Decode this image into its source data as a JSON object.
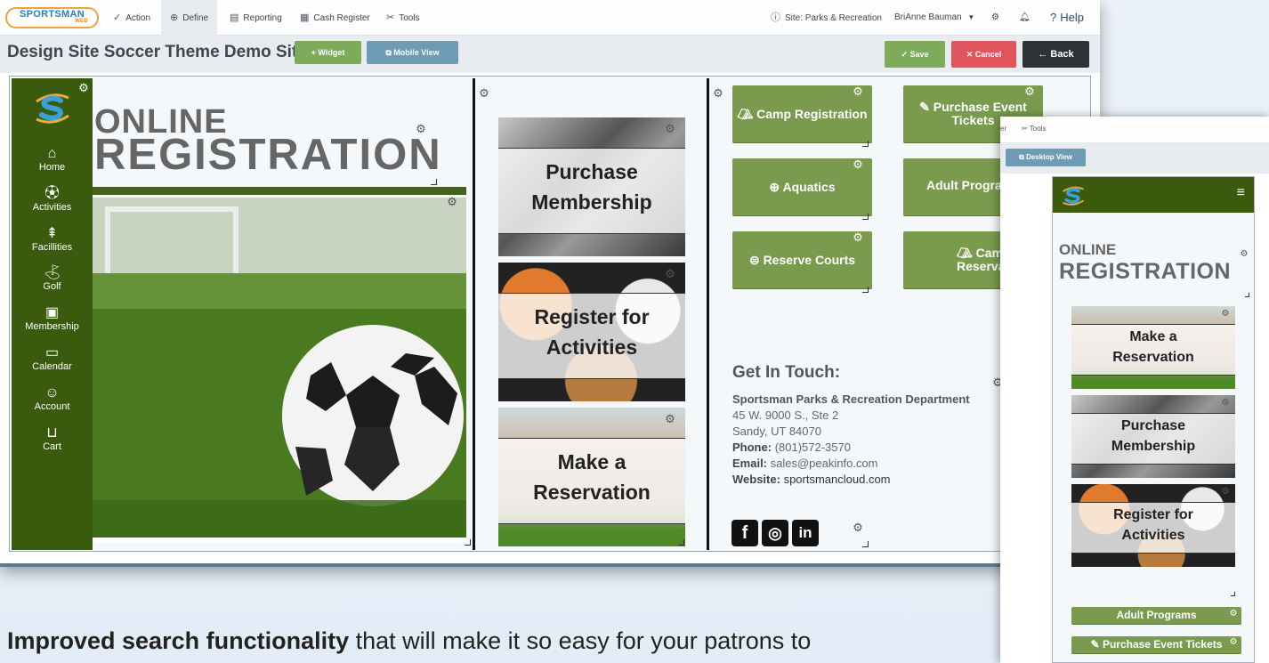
{
  "app": {
    "logo": {
      "text": "SPORTSMAN",
      "sub": "WEB"
    },
    "nav": [
      {
        "label": "Action",
        "icon": "check-icon"
      },
      {
        "label": "Define",
        "icon": "plus-circle-icon"
      },
      {
        "label": "Reporting",
        "icon": "document-icon"
      },
      {
        "label": "Cash Register",
        "icon": "register-icon"
      },
      {
        "label": "Tools",
        "icon": "tools-icon"
      }
    ],
    "site": "Site: Parks & Recreation",
    "user": "BriAnne Bauman",
    "help": "Help"
  },
  "toolbar": {
    "title": "Design Site Soccer Theme Demo Site",
    "widget": "Widget",
    "mobile_view": "Mobile View",
    "save": "Save",
    "cancel": "Cancel",
    "back": "Back"
  },
  "sidebar": {
    "items": [
      {
        "label": "Home",
        "icon": "home-icon"
      },
      {
        "label": "Activities",
        "icon": "soccer-ball-icon"
      },
      {
        "label": "Facillities",
        "icon": "tree-icon"
      },
      {
        "label": "Golf",
        "icon": "golf-icon"
      },
      {
        "label": "Membership",
        "icon": "id-card-icon"
      },
      {
        "label": "Calendar",
        "icon": "calendar-icon"
      },
      {
        "label": "Account",
        "icon": "user-icon"
      },
      {
        "label": "Cart",
        "icon": "cart-icon"
      }
    ]
  },
  "hero": {
    "line1": "ONLINE",
    "line2": "REGISTRATION"
  },
  "tiles": [
    {
      "title1": "Purchase",
      "title2": "Membership"
    },
    {
      "title1": "Register for",
      "title2": "Activities"
    },
    {
      "title1": "Make a",
      "title2": "Reservation"
    }
  ],
  "buttons": [
    {
      "label": "Camp Registration",
      "icon": "tent-icon"
    },
    {
      "label": "Purchase Event Tickets",
      "icon": "ticket-icon"
    },
    {
      "label": "Aquatics",
      "icon": "lifebuoy-icon"
    },
    {
      "label": "Adult Programs",
      "icon": ""
    },
    {
      "label": "Reserve Courts",
      "icon": "court-icon"
    },
    {
      "label": "Campsite Reservations",
      "icon": "tent-icon"
    }
  ],
  "contact": {
    "heading": "Get In Touch:",
    "org": "Sportsman Parks & Recreation Department",
    "address1": "45 W. 9000 S., Ste 2",
    "address2": "Sandy, UT 84070",
    "phone_label": "Phone:",
    "phone": "(801)572-3570",
    "email_label": "Email:",
    "email": "sales@peakinfo.com",
    "website_label": "Website:",
    "website": "sportsmancloud.com"
  },
  "social": [
    "facebook-icon",
    "instagram-icon",
    "linkedin-icon"
  ],
  "mobile": {
    "nav_partial": "er",
    "tools": "Tools",
    "desktop_view": "Desktop View",
    "menu_icon": "≡",
    "hero_line1": "ONLINE",
    "hero_line2": "REGISTRATION",
    "tiles": [
      {
        "title1": "Make a",
        "title2": "Reservation"
      },
      {
        "title1": "Purchase",
        "title2": "Membership"
      },
      {
        "title1": "Register for",
        "title2": "Activities"
      }
    ],
    "buttons": [
      {
        "label": "Adult Programs"
      },
      {
        "label": "Purchase Event Tickets"
      }
    ]
  },
  "caption": {
    "bold": "Improved search functionality",
    "rest": " that will make it so easy for your patrons to"
  },
  "colors": {
    "sidebar_green": "#3a5a0e",
    "button_green": "#7a9b4e",
    "save_green": "#7cac5a",
    "cancel_red": "#e1545b",
    "mobile_blue": "#6e9cb5"
  }
}
